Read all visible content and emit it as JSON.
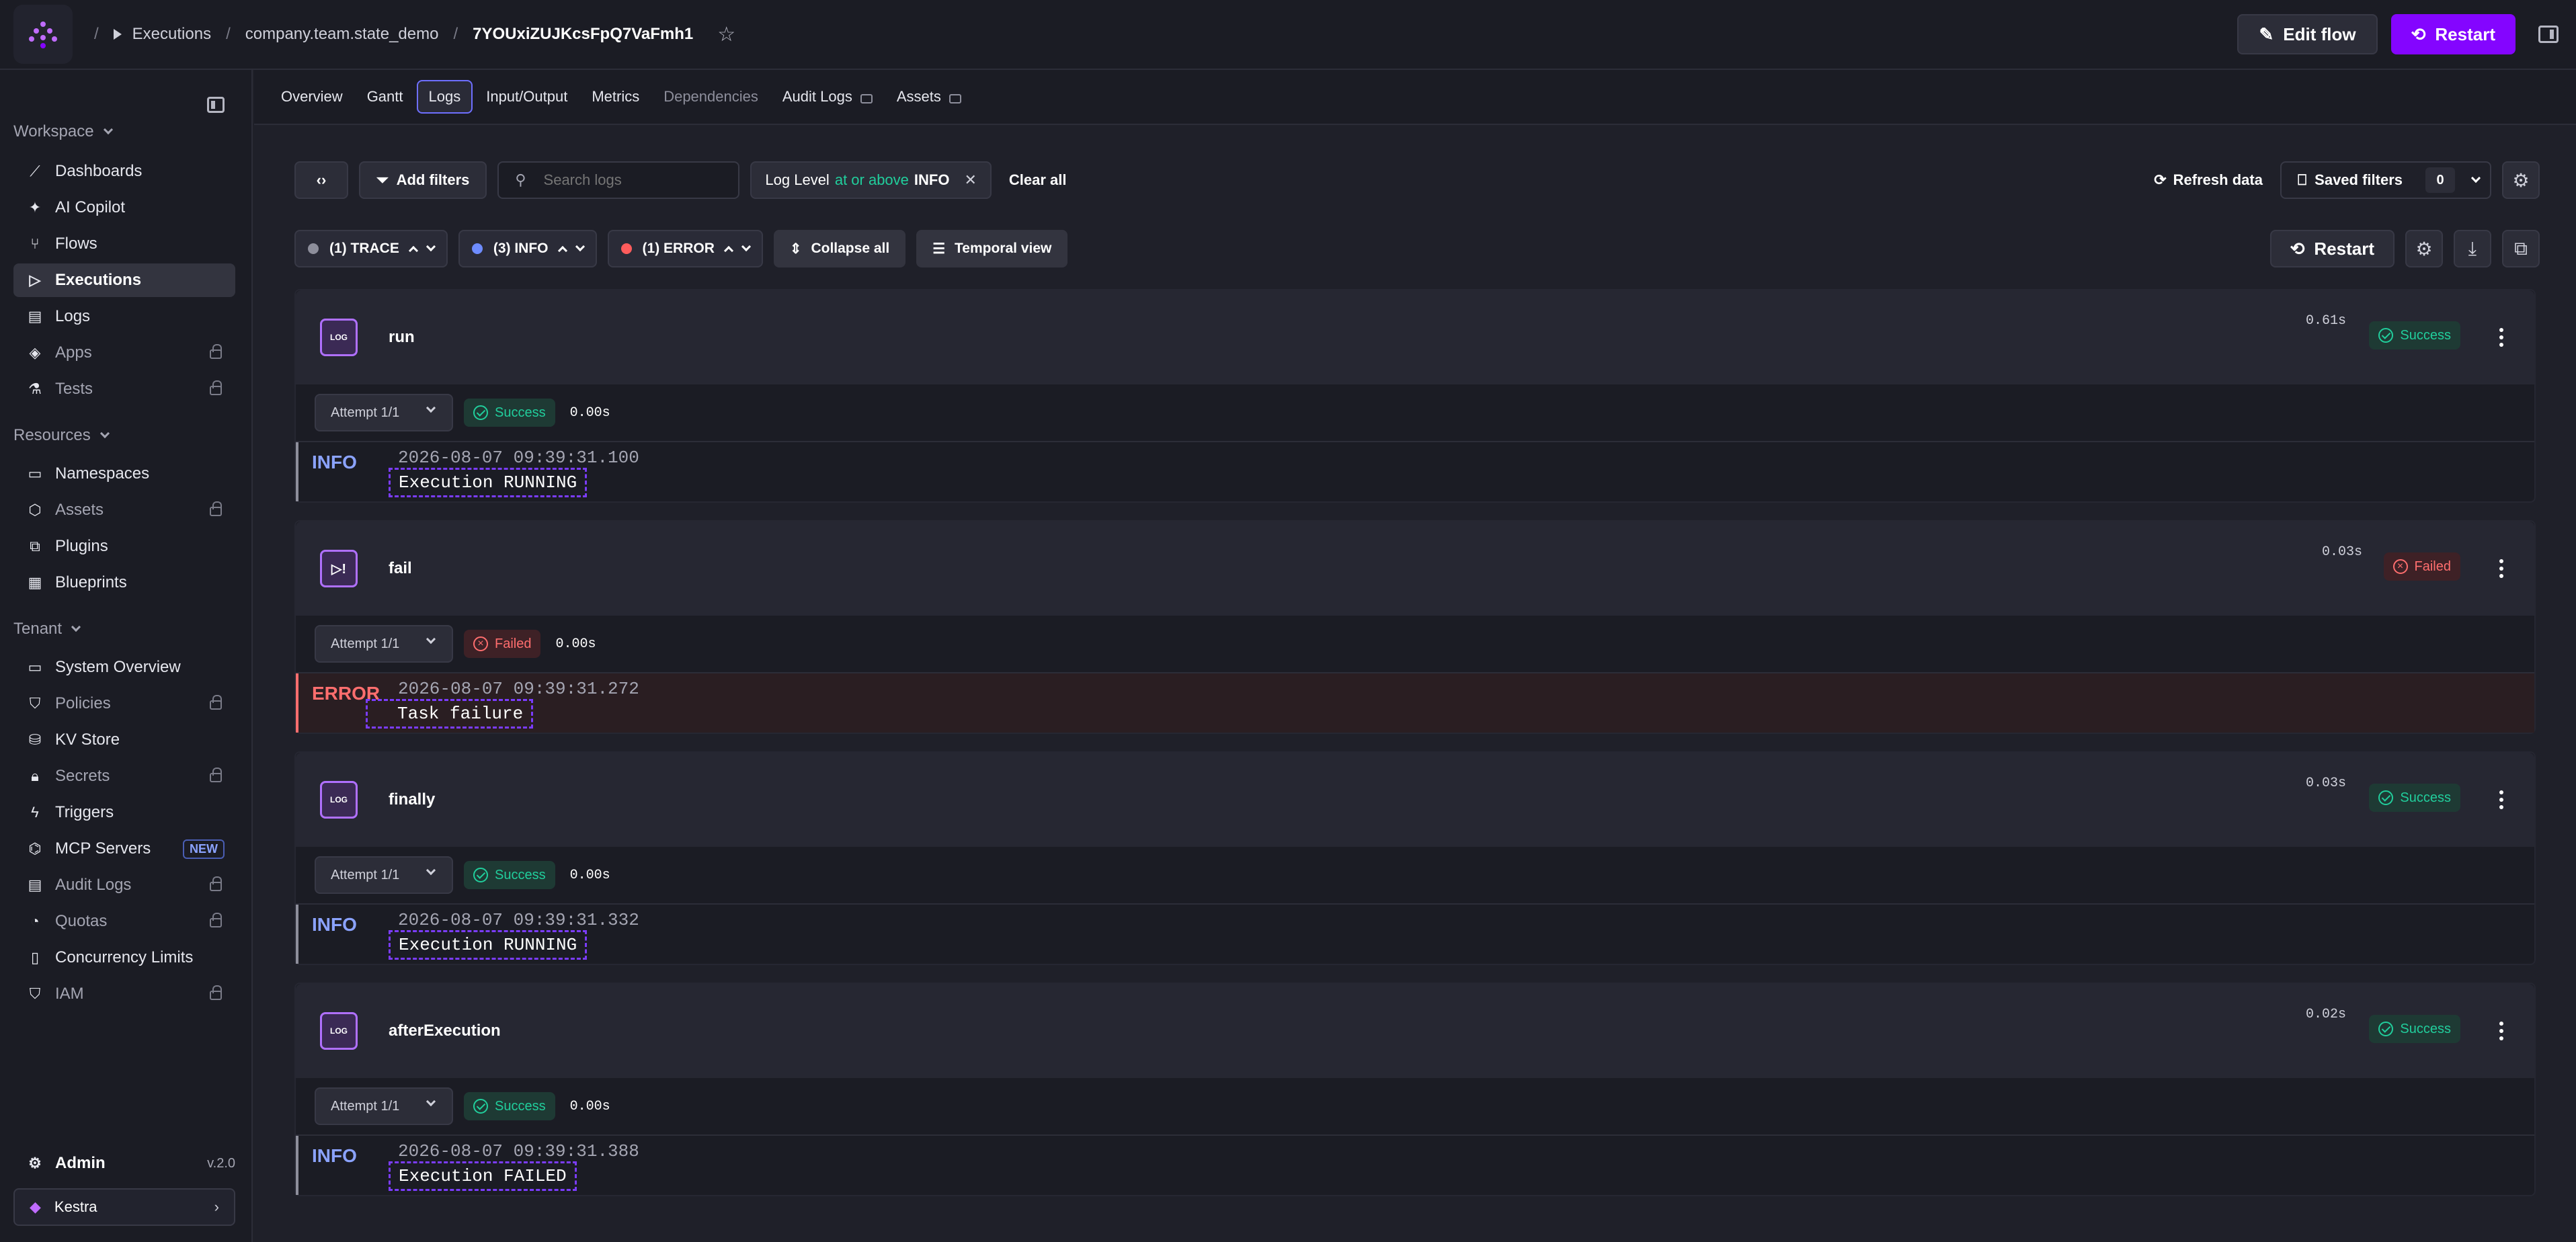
{
  "header": {
    "breadcrumbs": [
      "Executions",
      "company.team.state_demo",
      "7YOUxiZUJKcsFpQ7VaFmh1"
    ],
    "edit_flow": "Edit flow",
    "restart": "Restart"
  },
  "sidebar": {
    "workspace_title": "Workspace",
    "workspace_items": [
      {
        "label": "Dashboards",
        "icon": "chart-line-icon"
      },
      {
        "label": "AI Copilot",
        "icon": "sparkle-icon"
      },
      {
        "label": "Flows",
        "icon": "flow-icon"
      },
      {
        "label": "Executions",
        "icon": "play-icon",
        "active": true
      },
      {
        "label": "Logs",
        "icon": "file-icon"
      },
      {
        "label": "Apps",
        "icon": "layers-icon",
        "locked": true
      },
      {
        "label": "Tests",
        "icon": "flask-icon",
        "locked": true
      }
    ],
    "resources_title": "Resources",
    "resource_items": [
      {
        "label": "Namespaces",
        "icon": "folder-icon"
      },
      {
        "label": "Assets",
        "icon": "cube-icon",
        "locked": true
      },
      {
        "label": "Plugins",
        "icon": "puzzle-icon"
      },
      {
        "label": "Blueprints",
        "icon": "grid-icon"
      }
    ],
    "tenant_title": "Tenant",
    "tenant_items": [
      {
        "label": "System Overview",
        "icon": "monitor-icon"
      },
      {
        "label": "Policies",
        "icon": "shield-icon",
        "locked": true
      },
      {
        "label": "KV Store",
        "icon": "database-icon"
      },
      {
        "label": "Secrets",
        "icon": "lock-icon",
        "locked": true
      },
      {
        "label": "Triggers",
        "icon": "bolt-icon"
      },
      {
        "label": "MCP Servers",
        "icon": "mcp-icon",
        "badge": "NEW"
      },
      {
        "label": "Audit Logs",
        "icon": "file-icon",
        "locked": true
      },
      {
        "label": "Quotas",
        "icon": "gauge-icon",
        "locked": true
      },
      {
        "label": "Concurrency Limits",
        "icon": "battery-icon"
      },
      {
        "label": "IAM",
        "icon": "user-shield-icon",
        "locked": true
      }
    ],
    "admin": "Admin",
    "version": "v.2.0",
    "tenant": "Kestra"
  },
  "tabs": [
    {
      "label": "Overview"
    },
    {
      "label": "Gantt"
    },
    {
      "label": "Logs",
      "active": true
    },
    {
      "label": "Input/Output"
    },
    {
      "label": "Metrics"
    },
    {
      "label": "Dependencies",
      "disabled": true
    },
    {
      "label": "Audit Logs",
      "locked": true
    },
    {
      "label": "Assets",
      "locked": true
    }
  ],
  "filters": {
    "add_filters": "Add filters",
    "search_placeholder": "Search logs",
    "level_chip": {
      "label": "Log Level",
      "op": "at or above",
      "value": "INFO"
    },
    "clear_all": "Clear all",
    "refresh": "Refresh data",
    "saved_filters": "Saved filters",
    "saved_count": "0"
  },
  "levels": [
    {
      "label": "(1) TRACE",
      "color": "#8d8e9b"
    },
    {
      "label": "(3) INFO",
      "color": "#6e8cff"
    },
    {
      "label": "(1) ERROR",
      "color": "#ff5c5c"
    }
  ],
  "level_actions": {
    "collapse_all": "Collapse all",
    "temporal_view": "Temporal view",
    "restart": "Restart"
  },
  "tasks": [
    {
      "name": "run",
      "icon": "LOG",
      "duration": "0.61s",
      "status": "Success",
      "attempt": "Attempt 1/1",
      "attempt_status": "Success",
      "attempt_duration": "0.00s",
      "log": {
        "level": "INFO",
        "timestamp": "2026-08-07 09:39:31.100",
        "message": "Execution RUNNING"
      }
    },
    {
      "name": "fail",
      "icon": "FAIL",
      "duration": "0.03s",
      "status": "Failed",
      "attempt": "Attempt 1/1",
      "attempt_status": "Failed",
      "attempt_duration": "0.00s",
      "log": {
        "level": "ERROR",
        "timestamp": "2026-08-07 09:39:31.272",
        "message": "Task failure"
      }
    },
    {
      "name": "finally",
      "icon": "LOG",
      "duration": "0.03s",
      "status": "Success",
      "attempt": "Attempt 1/1",
      "attempt_status": "Success",
      "attempt_duration": "0.00s",
      "log": {
        "level": "INFO",
        "timestamp": "2026-08-07 09:39:31.332",
        "message": "Execution RUNNING"
      }
    },
    {
      "name": "afterExecution",
      "icon": "LOG",
      "duration": "0.02s",
      "status": "Success",
      "attempt": "Attempt 1/1",
      "attempt_status": "Success",
      "attempt_duration": "0.00s",
      "log": {
        "level": "INFO",
        "timestamp": "2026-08-07 09:39:31.388",
        "message": "Execution FAILED"
      }
    }
  ]
}
